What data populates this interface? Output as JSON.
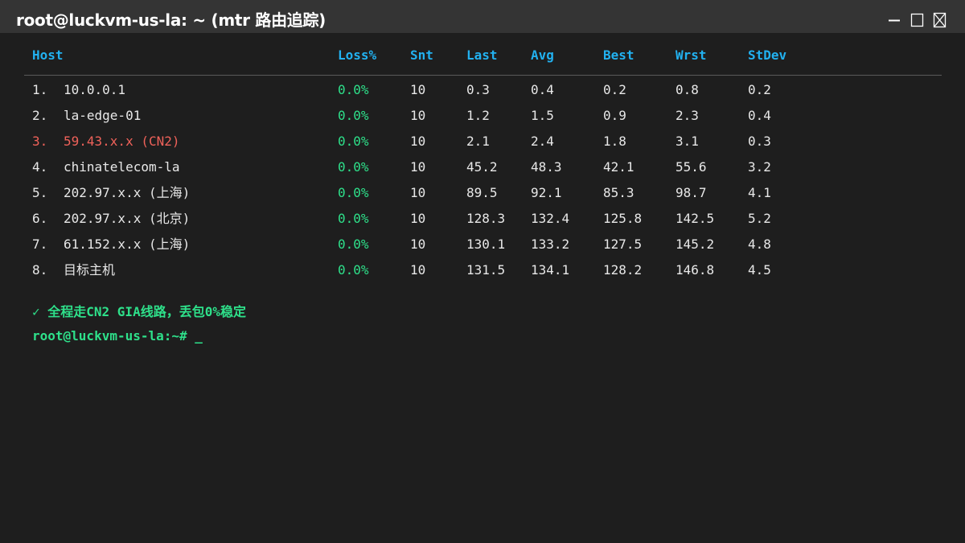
{
  "window": {
    "title": "root@luckvm-us-la: ~ (mtr 路由追踪)",
    "controls": {
      "minimize_icon": "minimize-icon",
      "maximize_icon": "maximize-icon",
      "close_icon": "close-icon"
    }
  },
  "table": {
    "headers": {
      "host": "Host",
      "loss": "Loss%",
      "snt": "Snt",
      "last": "Last",
      "avg": "Avg",
      "best": "Best",
      "wrst": "Wrst",
      "stdev": "StDev"
    },
    "rows": [
      {
        "num": "1.",
        "host": "10.0.0.1",
        "loss": "0.0%",
        "snt": "10",
        "last": "0.3",
        "avg": "0.4",
        "best": "0.2",
        "wrst": "0.8",
        "stdev": "0.2"
      },
      {
        "num": "2.",
        "host": "la-edge-01",
        "loss": "0.0%",
        "snt": "10",
        "last": "1.2",
        "avg": "1.5",
        "best": "0.9",
        "wrst": "2.3",
        "stdev": "0.4"
      },
      {
        "num": "3.",
        "host": "59.43.x.x (CN2)",
        "loss": "0.0%",
        "snt": "10",
        "last": "2.1",
        "avg": "2.4",
        "best": "1.8",
        "wrst": "3.1",
        "stdev": "0.3"
      },
      {
        "num": "4.",
        "host": "chinatelecom-la",
        "loss": "0.0%",
        "snt": "10",
        "last": "45.2",
        "avg": "48.3",
        "best": "42.1",
        "wrst": "55.6",
        "stdev": "3.2"
      },
      {
        "num": "5.",
        "host": "202.97.x.x (上海)",
        "loss": "0.0%",
        "snt": "10",
        "last": "89.5",
        "avg": "92.1",
        "best": "85.3",
        "wrst": "98.7",
        "stdev": "4.1"
      },
      {
        "num": "6.",
        "host": "202.97.x.x (北京)",
        "loss": "0.0%",
        "snt": "10",
        "last": "128.3",
        "avg": "132.4",
        "best": "125.8",
        "wrst": "142.5",
        "stdev": "5.2"
      },
      {
        "num": "7.",
        "host": "61.152.x.x (上海)",
        "loss": "0.0%",
        "snt": "10",
        "last": "130.1",
        "avg": "133.2",
        "best": "127.5",
        "wrst": "145.2",
        "stdev": "4.8"
      },
      {
        "num": "8.",
        "host": "目标主机",
        "loss": "0.0%",
        "snt": "10",
        "last": "131.5",
        "avg": "134.1",
        "best": "128.2",
        "wrst": "146.8",
        "stdev": "4.5"
      }
    ],
    "highlight_row_index": 2
  },
  "status_line": "✓ 全程走CN2 GIA线路，丢包0%稳定",
  "prompt": "root@luckvm-us-la:~# _",
  "colors": {
    "titlebar_bg": "#343434",
    "terminal_bg": "#1e1e1e",
    "header_text": "#22b1f0",
    "loss_text": "#2ee08a",
    "highlight_text": "#f0625a",
    "normal_text": "#e8e8e8",
    "prompt_text": "#2ee08a"
  }
}
